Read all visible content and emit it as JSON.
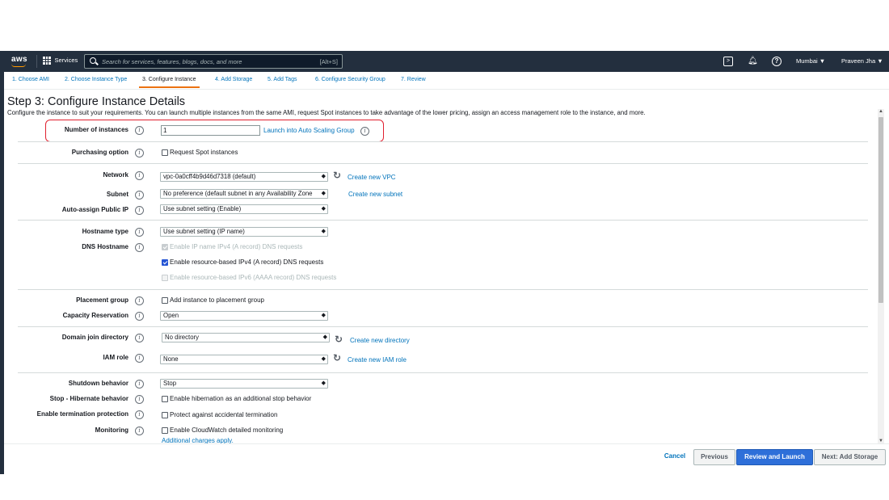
{
  "nav": {
    "logo": "aws",
    "services": "Services",
    "search_placeholder": "Search for services, features, blogs, docs, and more",
    "search_shortcut": "[Alt+S]",
    "region": "Mumbai ▼",
    "user": "Praveen Jha ▼"
  },
  "tabs": [
    "1. Choose AMI",
    "2. Choose Instance Type",
    "3. Configure Instance",
    "4. Add Storage",
    "5. Add Tags",
    "6. Configure Security Group",
    "7. Review"
  ],
  "active_tab": 2,
  "page": {
    "title": "Step 3: Configure Instance Details",
    "description": "Configure the instance to suit your requirements. You can launch multiple instances from the same AMI, request Spot instances to take advantage of the lower pricing, assign an access management role to the instance, and more."
  },
  "form": {
    "number_of_instances": {
      "label": "Number of instances",
      "value": "1",
      "link": "Launch into Auto Scaling Group"
    },
    "purchasing_option": {
      "label": "Purchasing option",
      "checkbox": "Request Spot instances"
    },
    "network": {
      "label": "Network",
      "value": "vpc-0a0cff4b9d46d7318 (default)",
      "link": "Create new VPC"
    },
    "subnet": {
      "label": "Subnet",
      "value": "No preference (default subnet in any Availability Zone",
      "link": "Create new subnet"
    },
    "public_ip": {
      "label": "Auto-assign Public IP",
      "value": "Use subnet setting (Enable)"
    },
    "hostname_type": {
      "label": "Hostname type",
      "value": "Use subnet setting (IP name)"
    },
    "dns_hostname": {
      "label": "DNS Hostname",
      "opt1": "Enable IP name IPv4 (A record) DNS requests",
      "opt2": "Enable resource-based IPv4 (A record) DNS requests",
      "opt3": "Enable resource-based IPv6 (AAAA record) DNS requests"
    },
    "placement_group": {
      "label": "Placement group",
      "checkbox": "Add instance to placement group"
    },
    "capacity_reservation": {
      "label": "Capacity Reservation",
      "value": "Open"
    },
    "domain_join": {
      "label": "Domain join directory",
      "value": "No directory",
      "link": "Create new directory"
    },
    "iam_role": {
      "label": "IAM role",
      "value": "None",
      "link": "Create new IAM role"
    },
    "shutdown": {
      "label": "Shutdown behavior",
      "value": "Stop"
    },
    "hibernate": {
      "label": "Stop - Hibernate behavior",
      "checkbox": "Enable hibernation as an additional stop behavior"
    },
    "termination": {
      "label": "Enable termination protection",
      "checkbox": "Protect against accidental termination"
    },
    "monitoring": {
      "label": "Monitoring",
      "checkbox": "Enable CloudWatch detailed monitoring",
      "link": "Additional charges apply."
    }
  },
  "footer": {
    "cancel": "Cancel",
    "previous": "Previous",
    "review": "Review and Launch",
    "next": "Next: Add Storage"
  }
}
